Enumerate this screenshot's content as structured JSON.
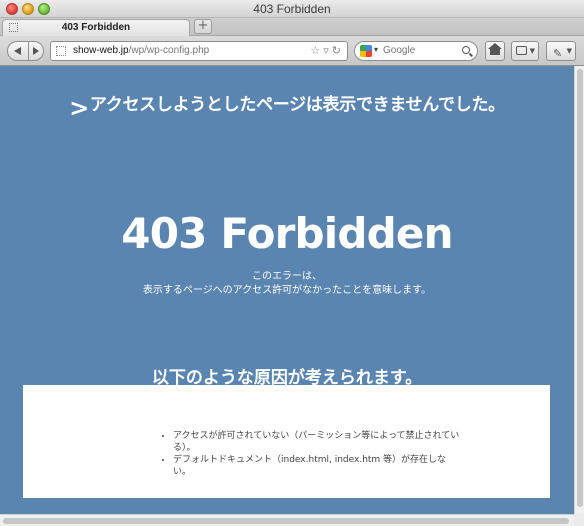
{
  "window": {
    "title": "403 Forbidden"
  },
  "tabs": [
    {
      "label": "403 Forbidden"
    }
  ],
  "new_tab_label": "+",
  "address_bar": {
    "host": "show-web.jp",
    "path": "/wp/wp-config.php"
  },
  "search_bar": {
    "engine": "Google",
    "placeholder": "Google"
  },
  "icons": {
    "back": "back-arrow-icon",
    "forward": "forward-arrow-icon",
    "bookmark_star": "star-icon",
    "reload": "reload-icon",
    "home": "home-icon",
    "search": "search-icon"
  },
  "page": {
    "background_color": "#5b85b1",
    "heading_arrow": ">",
    "heading": "アクセスしようとしたページは表示できませんでした。",
    "error_title": "403 Forbidden",
    "description_lines": [
      "このエラーは、",
      "表示するページへのアクセス許可がなかったことを意味します。"
    ],
    "causes_heading": "以下のような原因が考えられます。",
    "causes": [
      "アクセスが許可されていない（パーミッション等によって禁止されている）。",
      "デフォルトドキュメント（index.html, index.htm 等）が存在しない。"
    ]
  }
}
